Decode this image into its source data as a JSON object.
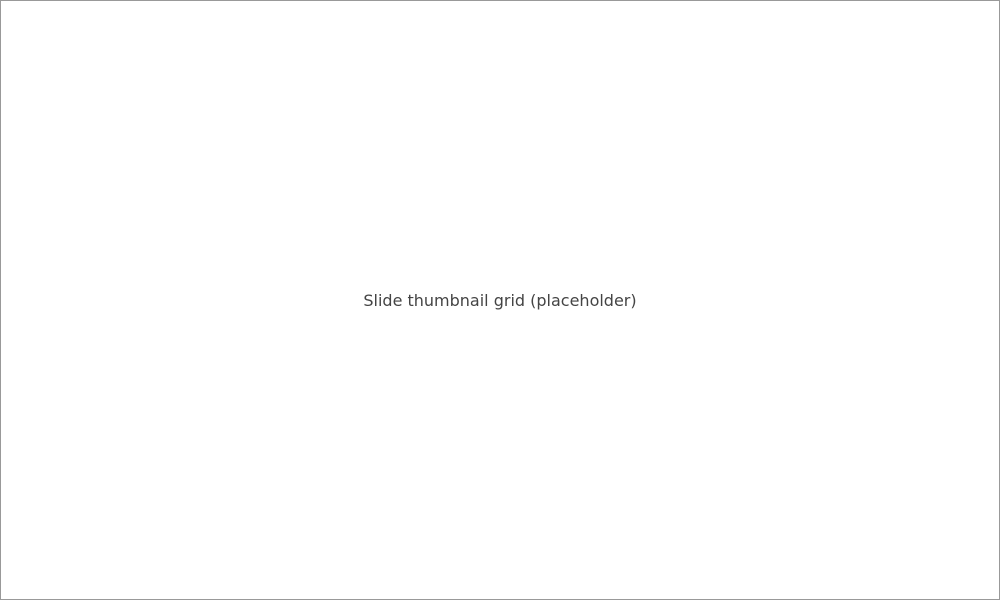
{
  "message": "Slide thumbnail grid (placeholder)"
}
